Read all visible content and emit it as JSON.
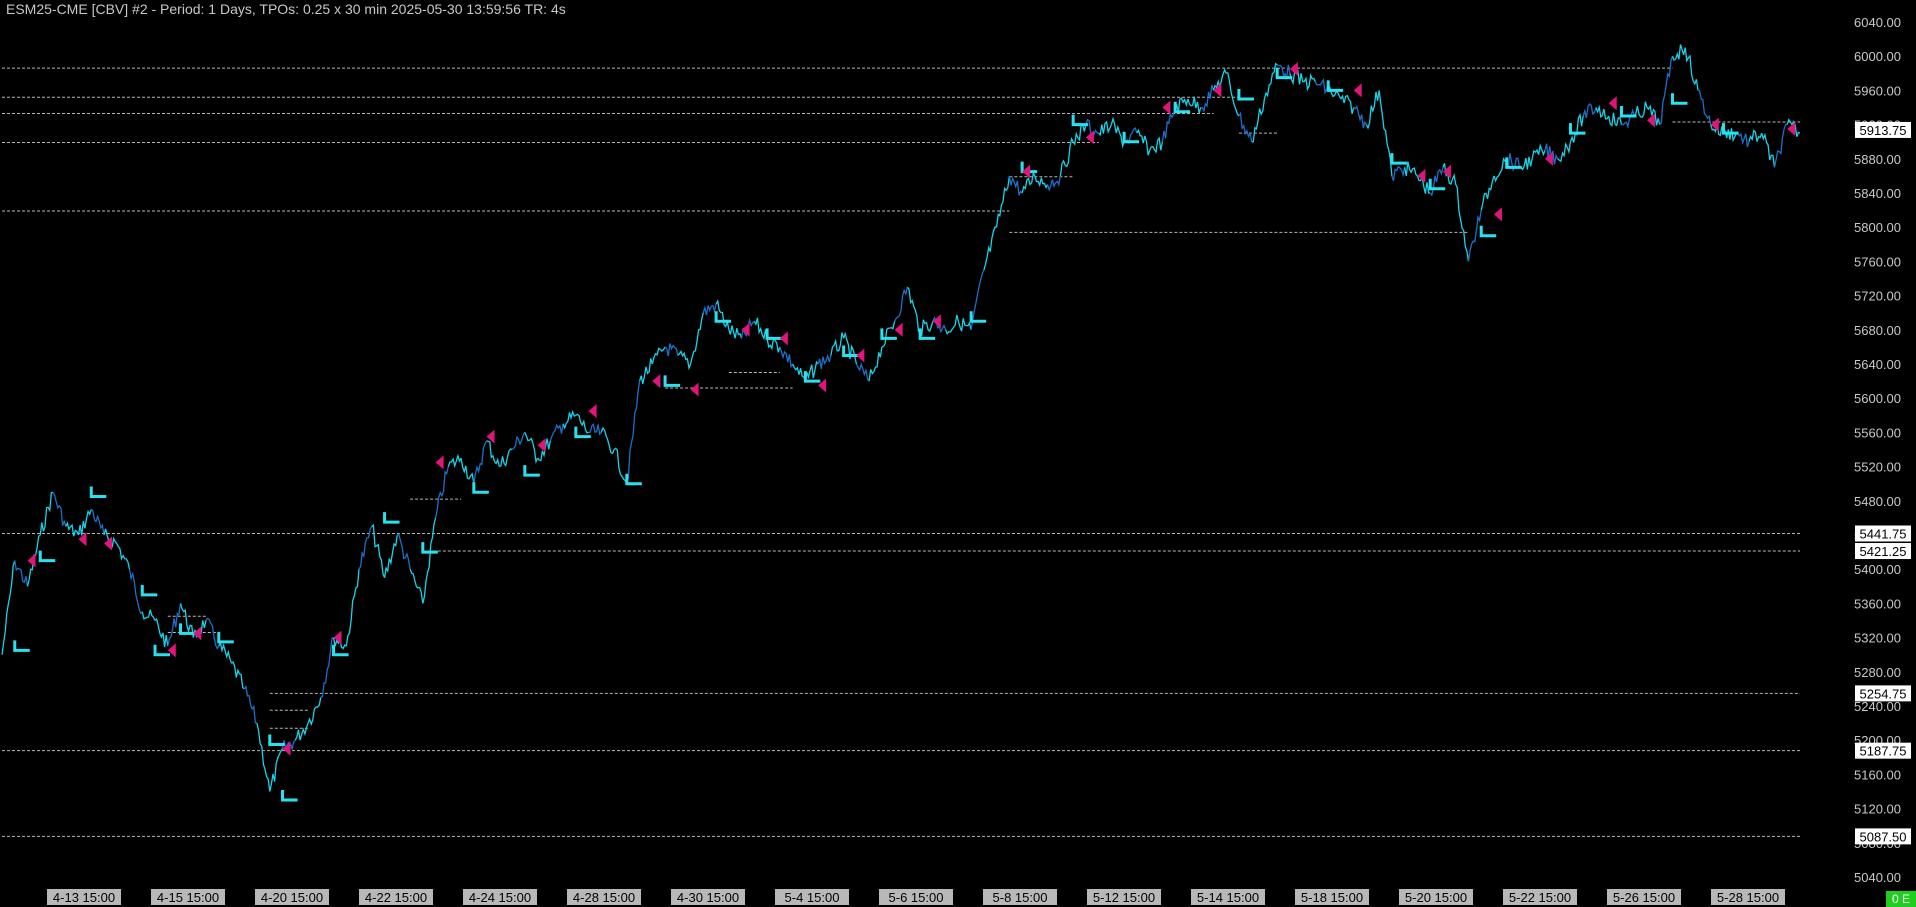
{
  "window": {
    "title": "ESM25-CME [CBV] #2 - Period: 1 Days, TPOs: 0.25 x 30 min   2025-05-30 13:59:56 TR: 4s",
    "status_badge": "0 E"
  },
  "colors": {
    "background": "#000000",
    "price_primary": "#17d4e8",
    "price_secondary": "#1d6fc9",
    "value_area": "#27e3f0",
    "poc_marker": "#e0147a",
    "reference_line": "#d8d8d8",
    "status_badge": "#1fcf1f"
  },
  "chart_data": {
    "type": "line",
    "title": "",
    "xlabel": "",
    "ylabel": "",
    "ylim": [
      5040,
      6040
    ],
    "y_ticks": [
      6040,
      6000,
      5960,
      5920,
      5880,
      5840,
      5800,
      5760,
      5720,
      5680,
      5640,
      5600,
      5560,
      5520,
      5480,
      5440,
      5400,
      5360,
      5320,
      5280,
      5240,
      5200,
      5160,
      5120,
      5080,
      5040
    ],
    "x_tick_labels": [
      "4-13  15:00",
      "4-15  15:00",
      "4-20  15:00",
      "4-22  15:00",
      "4-24  15:00",
      "4-28  15:00",
      "4-30  15:00",
      "5-4  15:00",
      "5-6  15:00",
      "5-8  15:00",
      "5-12  15:00",
      "5-14  15:00",
      "5-18  15:00",
      "5-20  15:00",
      "5-22  15:00",
      "5-26  15:00",
      "5-28  15:00"
    ],
    "grid": false,
    "legend": "none",
    "price_series": [
      [
        0,
        5300
      ],
      [
        1,
        5410
      ],
      [
        2,
        5380
      ],
      [
        3,
        5440
      ],
      [
        4,
        5490
      ],
      [
        5,
        5450
      ],
      [
        6,
        5440
      ],
      [
        7,
        5470
      ],
      [
        8,
        5440
      ],
      [
        9,
        5430
      ],
      [
        10,
        5400
      ],
      [
        11,
        5350
      ],
      [
        12,
        5340
      ],
      [
        13,
        5310
      ],
      [
        14,
        5360
      ],
      [
        15,
        5320
      ],
      [
        16,
        5340
      ],
      [
        17,
        5310
      ],
      [
        18,
        5290
      ],
      [
        19,
        5260
      ],
      [
        20,
        5220
      ],
      [
        21,
        5140
      ],
      [
        22,
        5190
      ],
      [
        23,
        5200
      ],
      [
        24,
        5220
      ],
      [
        25,
        5250
      ],
      [
        26,
        5320
      ],
      [
        27,
        5310
      ],
      [
        28,
        5400
      ],
      [
        29,
        5450
      ],
      [
        30,
        5390
      ],
      [
        31,
        5440
      ],
      [
        32,
        5400
      ],
      [
        33,
        5360
      ],
      [
        34,
        5460
      ],
      [
        35,
        5520
      ],
      [
        36,
        5530
      ],
      [
        37,
        5500
      ],
      [
        38,
        5550
      ],
      [
        39,
        5520
      ],
      [
        40,
        5540
      ],
      [
        41,
        5560
      ],
      [
        42,
        5530
      ],
      [
        43,
        5550
      ],
      [
        44,
        5570
      ],
      [
        45,
        5580
      ],
      [
        46,
        5560
      ],
      [
        47,
        5560
      ],
      [
        48,
        5540
      ],
      [
        49,
        5500
      ],
      [
        50,
        5620
      ],
      [
        51,
        5640
      ],
      [
        52,
        5660
      ],
      [
        53,
        5650
      ],
      [
        54,
        5640
      ],
      [
        55,
        5700
      ],
      [
        56,
        5710
      ],
      [
        57,
        5680
      ],
      [
        58,
        5670
      ],
      [
        59,
        5690
      ],
      [
        60,
        5670
      ],
      [
        61,
        5660
      ],
      [
        62,
        5640
      ],
      [
        63,
        5620
      ],
      [
        64,
        5640
      ],
      [
        65,
        5650
      ],
      [
        66,
        5670
      ],
      [
        67,
        5640
      ],
      [
        68,
        5620
      ],
      [
        69,
        5660
      ],
      [
        70,
        5690
      ],
      [
        71,
        5730
      ],
      [
        72,
        5680
      ],
      [
        73,
        5690
      ],
      [
        74,
        5680
      ],
      [
        75,
        5690
      ],
      [
        76,
        5680
      ],
      [
        77,
        5750
      ],
      [
        78,
        5800
      ],
      [
        79,
        5860
      ],
      [
        80,
        5840
      ],
      [
        81,
        5860
      ],
      [
        82,
        5850
      ],
      [
        83,
        5860
      ],
      [
        84,
        5900
      ],
      [
        85,
        5920
      ],
      [
        86,
        5910
      ],
      [
        87,
        5920
      ],
      [
        88,
        5900
      ],
      [
        89,
        5910
      ],
      [
        90,
        5890
      ],
      [
        91,
        5900
      ],
      [
        92,
        5940
      ],
      [
        93,
        5950
      ],
      [
        94,
        5940
      ],
      [
        95,
        5960
      ],
      [
        96,
        5980
      ],
      [
        97,
        5930
      ],
      [
        98,
        5900
      ],
      [
        99,
        5950
      ],
      [
        100,
        5990
      ],
      [
        101,
        5980
      ],
      [
        102,
        5970
      ],
      [
        103,
        5970
      ],
      [
        104,
        5960
      ],
      [
        105,
        5950
      ],
      [
        106,
        5940
      ],
      [
        107,
        5920
      ],
      [
        108,
        5960
      ],
      [
        109,
        5860
      ],
      [
        110,
        5870
      ],
      [
        111,
        5860
      ],
      [
        112,
        5840
      ],
      [
        113,
        5870
      ],
      [
        114,
        5850
      ],
      [
        115,
        5760
      ],
      [
        116,
        5820
      ],
      [
        117,
        5860
      ],
      [
        118,
        5880
      ],
      [
        119,
        5870
      ],
      [
        120,
        5880
      ],
      [
        121,
        5890
      ],
      [
        122,
        5880
      ],
      [
        123,
        5900
      ],
      [
        124,
        5930
      ],
      [
        125,
        5940
      ],
      [
        126,
        5930
      ],
      [
        127,
        5920
      ],
      [
        128,
        5930
      ],
      [
        129,
        5940
      ],
      [
        130,
        5920
      ],
      [
        131,
        6000
      ],
      [
        132,
        6010
      ],
      [
        133,
        5960
      ],
      [
        134,
        5920
      ],
      [
        135,
        5910
      ],
      [
        136,
        5910
      ],
      [
        137,
        5900
      ],
      [
        138,
        5910
      ],
      [
        139,
        5870
      ],
      [
        140,
        5920
      ],
      [
        141,
        5910
      ]
    ],
    "value_area_marks": [
      [
        1,
        5305
      ],
      [
        3,
        5410
      ],
      [
        7,
        5485
      ],
      [
        11,
        5370
      ],
      [
        12,
        5300
      ],
      [
        14,
        5325
      ],
      [
        17,
        5315
      ],
      [
        21,
        5195
      ],
      [
        22,
        5130
      ],
      [
        26,
        5300
      ],
      [
        30,
        5455
      ],
      [
        33,
        5420
      ],
      [
        37,
        5490
      ],
      [
        41,
        5510
      ],
      [
        45,
        5555
      ],
      [
        49,
        5500
      ],
      [
        52,
        5615
      ],
      [
        56,
        5690
      ],
      [
        60,
        5670
      ],
      [
        63,
        5620
      ],
      [
        66,
        5650
      ],
      [
        69,
        5670
      ],
      [
        72,
        5670
      ],
      [
        76,
        5690
      ],
      [
        80,
        5865
      ],
      [
        84,
        5920
      ],
      [
        88,
        5900
      ],
      [
        92,
        5935
      ],
      [
        97,
        5950
      ],
      [
        100,
        5975
      ],
      [
        104,
        5960
      ],
      [
        109,
        5875
      ],
      [
        112,
        5845
      ],
      [
        116,
        5790
      ],
      [
        118,
        5870
      ],
      [
        123,
        5910
      ],
      [
        127,
        5930
      ],
      [
        131,
        5945
      ],
      [
        135,
        5910
      ]
    ],
    "poc_marks": [
      [
        2,
        5410
      ],
      [
        6,
        5435
      ],
      [
        8,
        5430
      ],
      [
        13,
        5305
      ],
      [
        15,
        5325
      ],
      [
        22,
        5190
      ],
      [
        26,
        5320
      ],
      [
        34,
        5525
      ],
      [
        38,
        5555
      ],
      [
        42,
        5545
      ],
      [
        46,
        5585
      ],
      [
        51,
        5620
      ],
      [
        54,
        5610
      ],
      [
        58,
        5680
      ],
      [
        61,
        5670
      ],
      [
        64,
        5615
      ],
      [
        67,
        5650
      ],
      [
        70,
        5680
      ],
      [
        73,
        5690
      ],
      [
        80,
        5865
      ],
      [
        85,
        5905
      ],
      [
        91,
        5940
      ],
      [
        95,
        5960
      ],
      [
        101,
        5985
      ],
      [
        106,
        5960
      ],
      [
        111,
        5860
      ],
      [
        113,
        5865
      ],
      [
        117,
        5815
      ],
      [
        121,
        5880
      ],
      [
        126,
        5945
      ],
      [
        129,
        5925
      ],
      [
        134,
        5920
      ],
      [
        140,
        5915
      ]
    ],
    "reference_lines": [
      {
        "price": 5986,
        "x_start": 0,
        "x_end": 131
      },
      {
        "price": 5952,
        "x_start": 0,
        "x_end": 97
      },
      {
        "price": 5933,
        "x_start": 0,
        "x_end": 95
      },
      {
        "price": 5923,
        "x_start": 131,
        "x_end": 141
      },
      {
        "price": 5910,
        "x_start": 97,
        "x_end": 100
      },
      {
        "price": 5899,
        "x_start": 0,
        "x_end": 86
      },
      {
        "price": 5859,
        "x_start": 79,
        "x_end": 84
      },
      {
        "price": 5819,
        "x_start": 0,
        "x_end": 79
      },
      {
        "price": 5794,
        "x_start": 79,
        "x_end": 115
      },
      {
        "price": 5612,
        "x_start": 52,
        "x_end": 62
      },
      {
        "price": 5630,
        "x_start": 57,
        "x_end": 61
      },
      {
        "price": 5482,
        "x_start": 32,
        "x_end": 36
      },
      {
        "price": 5441.75,
        "x_start": 0,
        "x_end": 141
      },
      {
        "price": 5421.25,
        "x_start": 33,
        "x_end": 141
      },
      {
        "price": 5326,
        "x_start": 13,
        "x_end": 17
      },
      {
        "price": 5345,
        "x_start": 13,
        "x_end": 16
      },
      {
        "price": 5254.75,
        "x_start": 21,
        "x_end": 141
      },
      {
        "price": 5235,
        "x_start": 21,
        "x_end": 24
      },
      {
        "price": 5214,
        "x_start": 21,
        "x_end": 24
      },
      {
        "price": 5187.75,
        "x_start": 0,
        "x_end": 141
      },
      {
        "price": 5087.5,
        "x_start": 0,
        "x_end": 141
      }
    ],
    "marked_prices": [
      {
        "price": 5913.75,
        "label": "5913.75"
      },
      {
        "price": 5441.75,
        "label": "5441.75"
      },
      {
        "price": 5421.25,
        "label": "5421.25"
      },
      {
        "price": 5254.75,
        "label": "5254.75"
      },
      {
        "price": 5187.75,
        "label": "5187.75"
      },
      {
        "price": 5087.5,
        "label": "5087.50"
      }
    ]
  }
}
